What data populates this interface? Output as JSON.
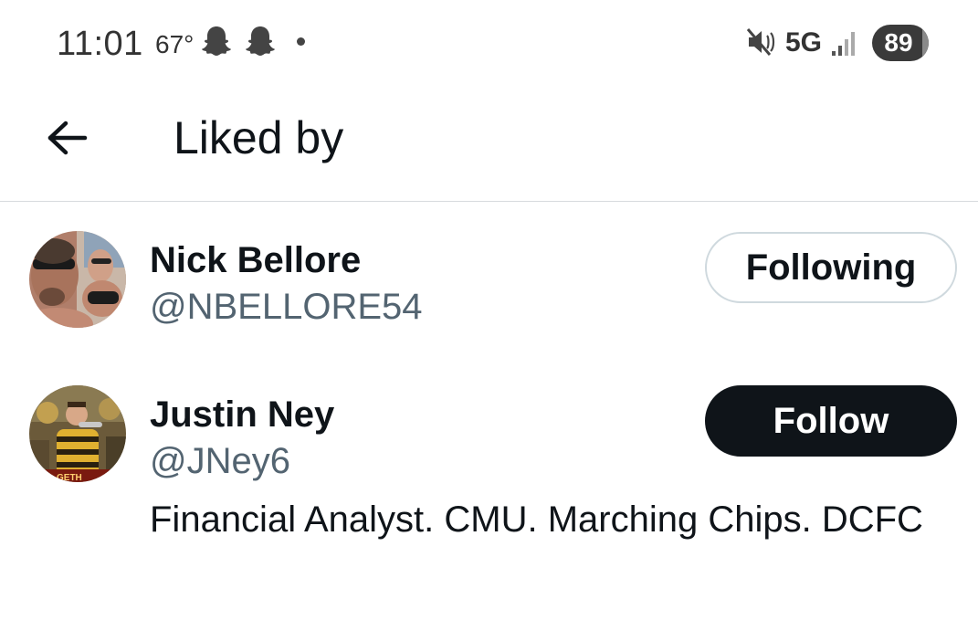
{
  "status_bar": {
    "time": "11:01",
    "temperature": "67°",
    "notification_icons": [
      "snapchat-icon",
      "snapchat-icon"
    ],
    "network": "5G",
    "battery": "89",
    "battery_level": 0.89,
    "icon_color": "#444444"
  },
  "header": {
    "back_icon": "arrow-left-icon",
    "title": "Liked by"
  },
  "users": [
    {
      "display_name": "Nick Bellore",
      "handle": "@NBELLORE54",
      "button_label": "Following",
      "button_state": "following",
      "bio": ""
    },
    {
      "display_name": "Justin Ney",
      "handle": "@JNey6",
      "button_label": "Follow",
      "button_state": "follow",
      "bio": "Financial Analyst. CMU. Marching Chips. DCFC"
    }
  ],
  "colors": {
    "text_primary": "#0f1419",
    "text_secondary": "#536471",
    "divider": "#d7dade",
    "follow_button_bg": "#0f1419",
    "following_button_border": "#cfd9de"
  }
}
